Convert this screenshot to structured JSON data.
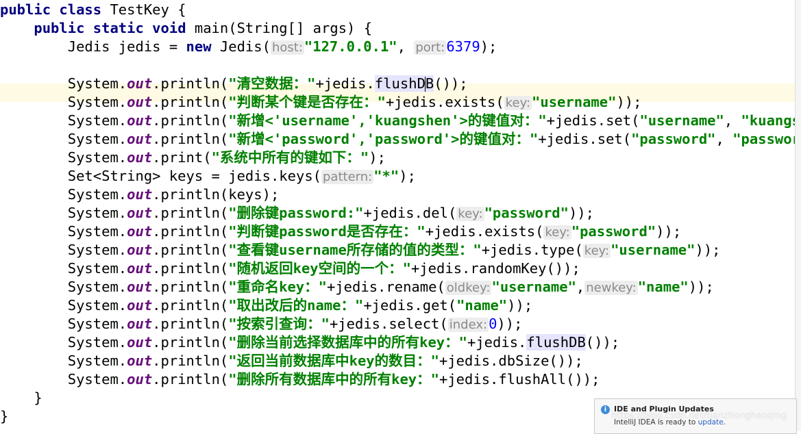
{
  "code_lines": [
    [
      [
        "kw",
        "public class "
      ],
      [
        "p",
        "TestKey {"
      ]
    ],
    [
      [
        "p",
        "    "
      ],
      [
        "kw",
        "public static void "
      ],
      [
        "p",
        "main(String[] args) {"
      ]
    ],
    [
      [
        "p",
        "        Jedis jedis = "
      ],
      [
        "kw",
        "new "
      ],
      [
        "p",
        "Jedis("
      ],
      [
        "hint",
        "host:"
      ],
      [
        "str",
        "\"127.0.0.1\""
      ],
      [
        "p",
        ", "
      ],
      [
        "hint",
        "port:"
      ],
      [
        "num",
        "6379"
      ],
      [
        "p",
        ");"
      ]
    ],
    [],
    [
      [
        "p",
        "        System."
      ],
      [
        "field",
        "out"
      ],
      [
        "p",
        ".println("
      ],
      [
        "str",
        "\"清空数据：\""
      ],
      [
        "p",
        "+jedis."
      ],
      [
        "sel",
        "flushD"
      ],
      [
        "caret",
        ""
      ],
      [
        "sel",
        "B"
      ],
      [
        "p",
        "());"
      ]
    ],
    [
      [
        "p",
        "        System."
      ],
      [
        "field",
        "out"
      ],
      [
        "p",
        ".println("
      ],
      [
        "str",
        "\"判断某个键是否存在：\""
      ],
      [
        "p",
        "+jedis.exists("
      ],
      [
        "hint",
        "key:"
      ],
      [
        "str",
        "\"username\""
      ],
      [
        "p",
        "));"
      ]
    ],
    [
      [
        "p",
        "        System."
      ],
      [
        "field",
        "out"
      ],
      [
        "p",
        ".println("
      ],
      [
        "str",
        "\"新增<'username','kuangshen'>的键值对：\""
      ],
      [
        "p",
        "+jedis.set("
      ],
      [
        "str",
        "\"username\""
      ],
      [
        "p",
        ", "
      ],
      [
        "str",
        "\"kuangshen\""
      ],
      [
        "p",
        "));"
      ]
    ],
    [
      [
        "p",
        "        System."
      ],
      [
        "field",
        "out"
      ],
      [
        "p",
        ".println("
      ],
      [
        "str",
        "\"新增<'password','password'>的键值对：\""
      ],
      [
        "p",
        "+jedis.set("
      ],
      [
        "str",
        "\"password\""
      ],
      [
        "p",
        ", "
      ],
      [
        "str",
        "\"password\""
      ],
      [
        "p",
        "));"
      ]
    ],
    [
      [
        "p",
        "        System."
      ],
      [
        "field",
        "out"
      ],
      [
        "p",
        ".print("
      ],
      [
        "str",
        "\"系统中所有的键如下：\""
      ],
      [
        "p",
        ");"
      ]
    ],
    [
      [
        "p",
        "        Set<String> keys = jedis.keys("
      ],
      [
        "hint",
        "pattern:"
      ],
      [
        "str",
        "\"*\""
      ],
      [
        "p",
        ");"
      ]
    ],
    [
      [
        "p",
        "        System."
      ],
      [
        "field",
        "out"
      ],
      [
        "p",
        ".println(keys);"
      ]
    ],
    [
      [
        "p",
        "        System."
      ],
      [
        "field",
        "out"
      ],
      [
        "p",
        ".println("
      ],
      [
        "str",
        "\"删除键password:\""
      ],
      [
        "p",
        "+jedis.del("
      ],
      [
        "hint",
        "key:"
      ],
      [
        "str",
        "\"password\""
      ],
      [
        "p",
        "));"
      ]
    ],
    [
      [
        "p",
        "        System."
      ],
      [
        "field",
        "out"
      ],
      [
        "p",
        ".println("
      ],
      [
        "str",
        "\"判断键password是否存在：\""
      ],
      [
        "p",
        "+jedis.exists("
      ],
      [
        "hint",
        "key:"
      ],
      [
        "str",
        "\"password\""
      ],
      [
        "p",
        "));"
      ]
    ],
    [
      [
        "p",
        "        System."
      ],
      [
        "field",
        "out"
      ],
      [
        "p",
        ".println("
      ],
      [
        "str",
        "\"查看键username所存储的值的类型：\""
      ],
      [
        "p",
        "+jedis.type("
      ],
      [
        "hint",
        "key:"
      ],
      [
        "str",
        "\"username\""
      ],
      [
        "p",
        "));"
      ]
    ],
    [
      [
        "p",
        "        System."
      ],
      [
        "field",
        "out"
      ],
      [
        "p",
        ".println("
      ],
      [
        "str",
        "\"随机返回key空间的一个：\""
      ],
      [
        "p",
        "+jedis.randomKey());"
      ]
    ],
    [
      [
        "p",
        "        System."
      ],
      [
        "field",
        "out"
      ],
      [
        "p",
        ".println("
      ],
      [
        "str",
        "\"重命名key：\""
      ],
      [
        "p",
        "+jedis.rename("
      ],
      [
        "hint",
        "oldkey:"
      ],
      [
        "str",
        "\"username\""
      ],
      [
        "p",
        ","
      ],
      [
        "hint",
        "newkey:"
      ],
      [
        "str",
        "\"name\""
      ],
      [
        "p",
        "));"
      ]
    ],
    [
      [
        "p",
        "        System."
      ],
      [
        "field",
        "out"
      ],
      [
        "p",
        ".println("
      ],
      [
        "str",
        "\"取出改后的name：\""
      ],
      [
        "p",
        "+jedis.get("
      ],
      [
        "str",
        "\"name\""
      ],
      [
        "p",
        "));"
      ]
    ],
    [
      [
        "p",
        "        System."
      ],
      [
        "field",
        "out"
      ],
      [
        "p",
        ".println("
      ],
      [
        "str",
        "\"按索引查询：\""
      ],
      [
        "p",
        "+jedis.select("
      ],
      [
        "hint",
        "index:"
      ],
      [
        "num",
        "0"
      ],
      [
        "p",
        "));"
      ]
    ],
    [
      [
        "p",
        "        System."
      ],
      [
        "field",
        "out"
      ],
      [
        "p",
        ".println("
      ],
      [
        "str",
        "\"删除当前选择数据库中的所有key：\""
      ],
      [
        "p",
        "+jedis."
      ],
      [
        "sel",
        "flushDB"
      ],
      [
        "p",
        "());"
      ]
    ],
    [
      [
        "p",
        "        System."
      ],
      [
        "field",
        "out"
      ],
      [
        "p",
        ".println("
      ],
      [
        "str",
        "\"返回当前数据库中key的数目：\""
      ],
      [
        "p",
        "+jedis.dbSize());"
      ]
    ],
    [
      [
        "p",
        "        System."
      ],
      [
        "field",
        "out"
      ],
      [
        "p",
        ".println("
      ],
      [
        "str",
        "\"删除所有数据库中的所有key：\""
      ],
      [
        "p",
        "+jedis.flushAll());"
      ]
    ],
    [
      [
        "p",
        "    }"
      ]
    ],
    [
      [
        "p",
        "}"
      ]
    ]
  ],
  "notification": {
    "icon": "info-icon",
    "title": "IDE and Plugin Updates",
    "message": "IntelliJ IDEA is ready to ",
    "link": "update",
    "suffix": "."
  },
  "watermark": "https://blog.csdn.net/tianzhonghaoqing",
  "colors": {
    "keyword": "#000080",
    "string": "#008000",
    "field": "#660e7a",
    "number": "#0000ff",
    "current_line": "#fffae3"
  }
}
